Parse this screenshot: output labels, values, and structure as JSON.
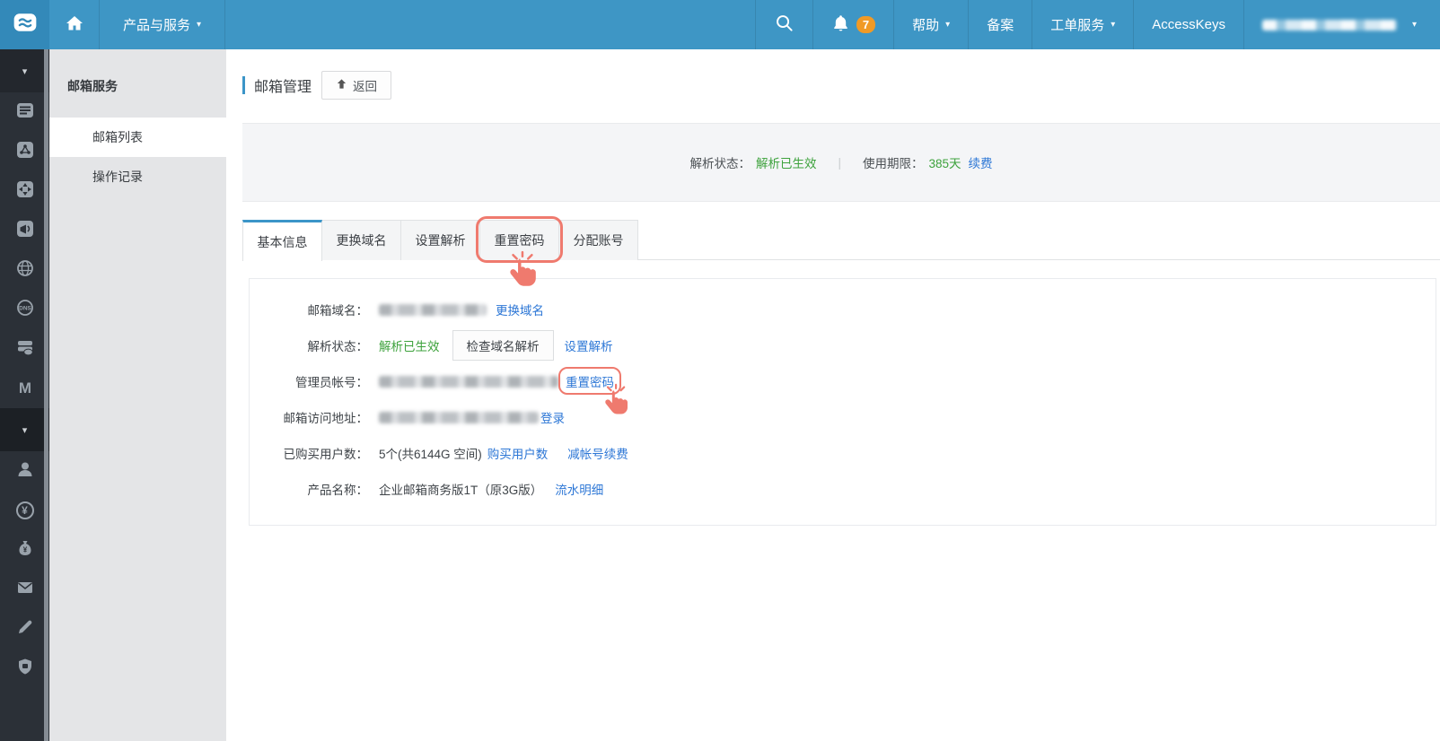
{
  "topbar": {
    "product_services": "产品与服务",
    "caret": "▾",
    "notifications": {
      "count": "7"
    },
    "help": "帮助",
    "beian": "备案",
    "ticket_service": "工单服务",
    "accesskeys": "AccessKeys"
  },
  "iconbar": {
    "group1_icons": [
      "server-list",
      "app-nodes",
      "cross-arrows",
      "announce",
      "globe",
      "dns",
      "storage",
      "letter-m"
    ],
    "group2_icons": [
      "user",
      "yen-circle",
      "money-bag",
      "envelope",
      "pencil",
      "shield"
    ],
    "glyphs": {
      "m": "M",
      "yen": "¥",
      "dns": "DNS"
    },
    "collapse_caret": "▾"
  },
  "subsidebar": {
    "header": "邮箱服务",
    "items": [
      {
        "label": "邮箱列表",
        "selected": true
      },
      {
        "label": "操作记录",
        "selected": false
      }
    ]
  },
  "page": {
    "title": "邮箱管理",
    "back_label": "返回"
  },
  "statusbar": {
    "resolve_label": "解析状态：",
    "resolve_value": "解析已生效",
    "divider": "|",
    "period_label": "使用期限：",
    "period_value": "385天",
    "renew_link": "续费"
  },
  "tabs": [
    {
      "label": "基本信息",
      "active": true
    },
    {
      "label": "更换域名",
      "active": false
    },
    {
      "label": "设置解析",
      "active": false
    },
    {
      "label": "重置密码",
      "active": false,
      "annotated": true
    },
    {
      "label": "分配账号",
      "active": false
    }
  ],
  "details": {
    "rows": [
      {
        "label": "邮箱域名：",
        "redacted": true,
        "link": "更换域名"
      },
      {
        "label": "解析状态：",
        "value": "解析已生效",
        "button": "检查域名解析",
        "link": "设置解析"
      },
      {
        "label": "管理员帐号：",
        "redacted": true,
        "link": "重置密码",
        "annotated": true
      },
      {
        "label": "邮箱访问地址：",
        "redacted": true,
        "link": "登录"
      },
      {
        "label": "已购买用户数：",
        "value": "5个(共6144G 空间)",
        "link": "购买用户数",
        "link2": "减帐号续费"
      },
      {
        "label": "产品名称：",
        "value": "企业邮箱商务版1T（原3G版）",
        "link": "流水明细"
      }
    ]
  },
  "colors": {
    "topbar_blue": "#3E96C5",
    "logo_blue": "#3389B9",
    "sidebar_dark": "#2B3037",
    "accent_blue": "#3B95C8",
    "link_blue": "#2D77D6",
    "success_green": "#3EA23D",
    "badge_orange": "#F09A26",
    "annotation_coral": "#EF7A6E"
  }
}
